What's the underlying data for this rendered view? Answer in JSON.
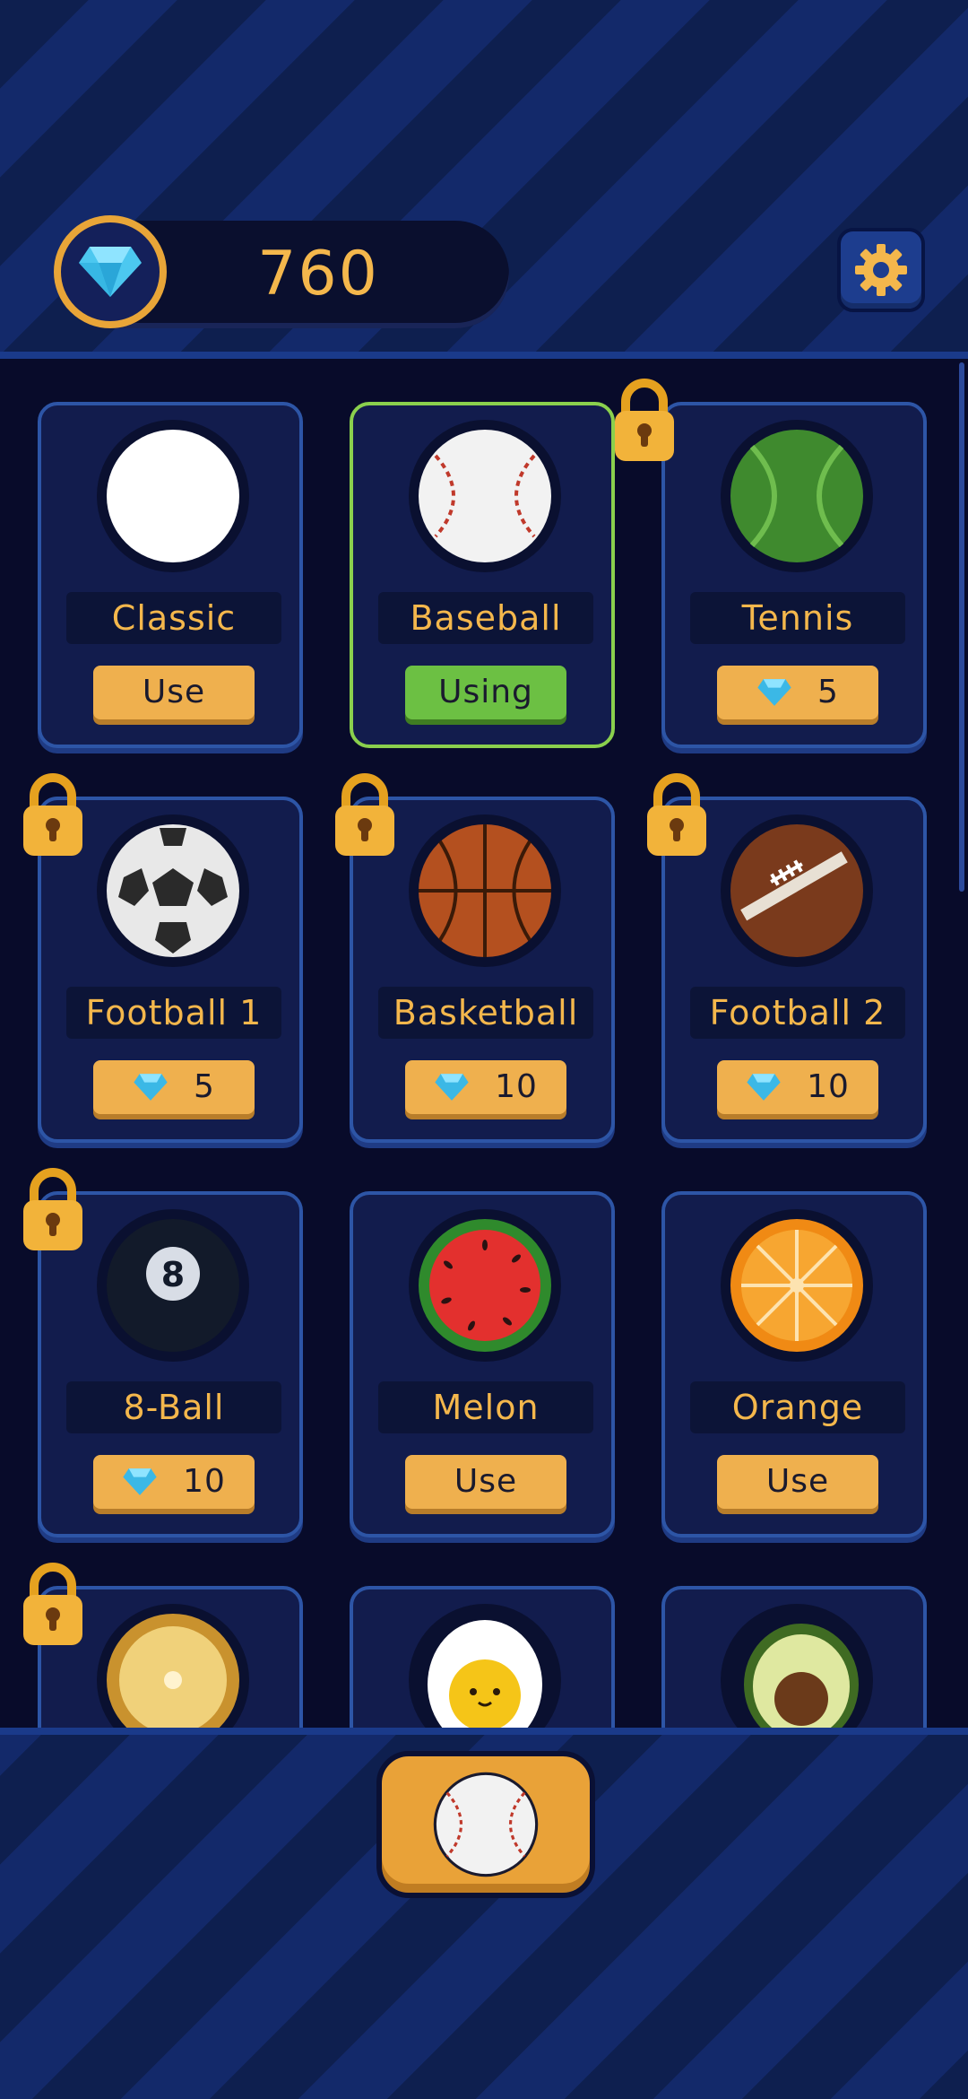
{
  "header": {
    "gem_count": "760",
    "settings_icon": "gear-icon"
  },
  "colors": {
    "accent": "#f4b74c",
    "button": "#efb04e",
    "using": "#6cc043",
    "card_border": "#2d55a6",
    "selected_border": "#8ad04d"
  },
  "balls": [
    {
      "name": "Classic",
      "icon": "classic-ball-icon",
      "state": "use",
      "label": "Use",
      "locked": false
    },
    {
      "name": "Baseball",
      "icon": "baseball-icon",
      "state": "using",
      "label": "Using",
      "locked": false
    },
    {
      "name": "Tennis",
      "icon": "tennis-ball-icon",
      "state": "price",
      "price": "5",
      "locked": true
    },
    {
      "name": "Football 1",
      "icon": "soccer-ball-icon",
      "state": "price",
      "price": "5",
      "locked": true
    },
    {
      "name": "Basketball",
      "icon": "basketball-icon",
      "state": "price",
      "price": "10",
      "locked": true
    },
    {
      "name": "Football 2",
      "icon": "american-football-icon",
      "state": "price",
      "price": "10",
      "locked": true
    },
    {
      "name": "8-Ball",
      "icon": "eight-ball-icon",
      "state": "price",
      "price": "10",
      "locked": true
    },
    {
      "name": "Melon",
      "icon": "melon-icon",
      "state": "use",
      "label": "Use",
      "locked": false
    },
    {
      "name": "Orange",
      "icon": "orange-icon",
      "state": "use",
      "label": "Use",
      "locked": false
    },
    {
      "name": "",
      "icon": "pineapple-ball-icon",
      "locked": true
    },
    {
      "name": "",
      "icon": "egg-ball-icon",
      "locked": false
    },
    {
      "name": "",
      "icon": "avocado-ball-icon",
      "locked": false
    }
  ],
  "bottom": {
    "selected_ball_icon": "baseball-icon"
  }
}
